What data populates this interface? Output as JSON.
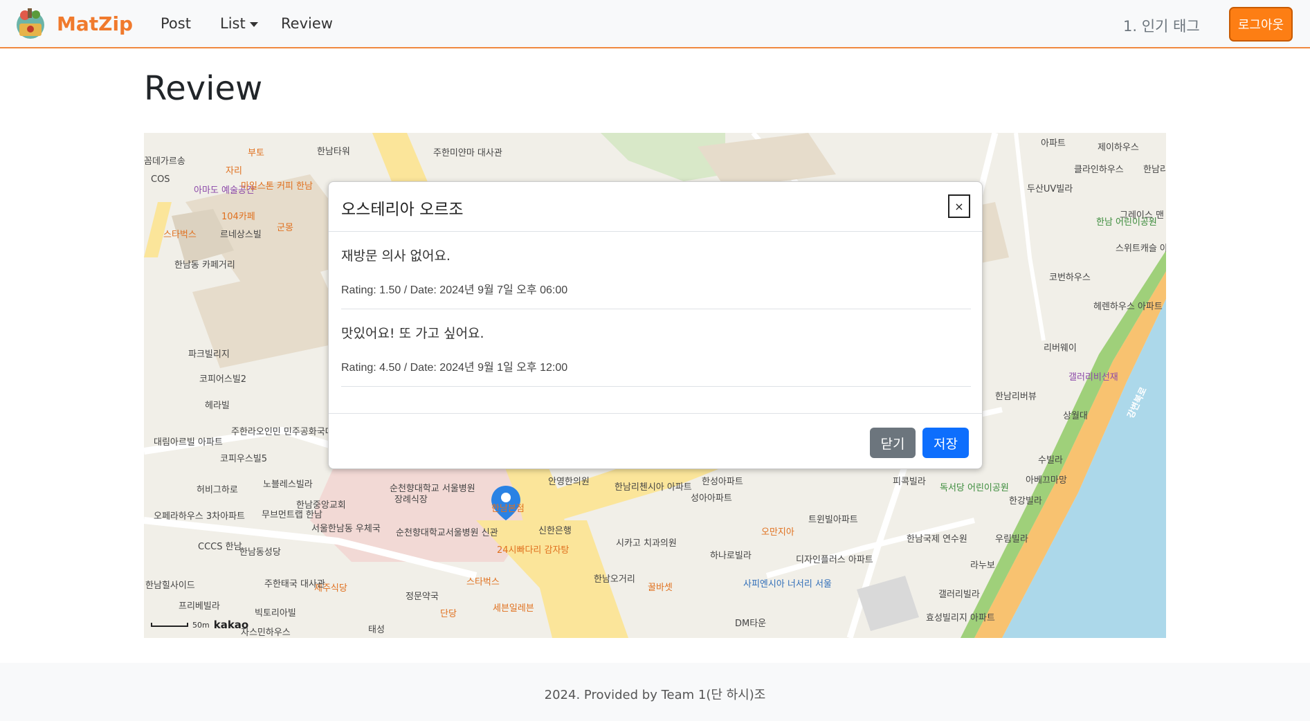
{
  "navbar": {
    "brand": "MatZip",
    "links": {
      "post": "Post",
      "list": "List",
      "review": "Review"
    },
    "tag_text": "1. 인기 태그",
    "logout_label": "로그아웃"
  },
  "page": {
    "title": "Review"
  },
  "map": {
    "scale_label": "50m",
    "logo": "kakao",
    "labels": {
      "l1": "꼼데가르송",
      "l2": "COS",
      "l3": "부토",
      "l4": "자리",
      "l5": "한남타워",
      "l6": "주한미얀마 대사관",
      "l7": "순천향대학교 서울병원",
      "l8": "안영한의원",
      "l9": "한남리첸시아 아파트",
      "l10": "한성아파트",
      "l11": "성아아파트",
      "l12": "피콕빌라",
      "l13": "독서당 어린이공원",
      "l14": "아베끄마망",
      "l15": "한강빌라",
      "l16": "우림빌라",
      "l17": "라누보",
      "l18": "갤러리빌라",
      "l19": "효성빌리지 아파트",
      "l20": "DM타운",
      "l21": "한남오거리",
      "l22": "하나로빌라",
      "l23": "디자인플러스 아파트",
      "l24": "사피엔시아 너서리 서울",
      "l25": "스타벅스",
      "l26": "세븐일레븐",
      "l27": "단당",
      "l28": "정문약국",
      "l29": "제주식당",
      "l30": "주한태국 대사관",
      "l31": "빅토리아빌",
      "l32": "프리베빌라",
      "l33": "한남힐사이드",
      "l34": "한남동성당",
      "l35": "서울한남동 우체국",
      "l36": "한남중앙교회",
      "l37": "무브먼트랩 한남",
      "l38": "노블레스빌라",
      "l39": "허비그하로",
      "l40": "대림아르빌 아파트",
      "l41": "주한라오인민 민주공화국대사관",
      "l42": "코피우스빌5",
      "l43": "헤라빌",
      "l44": "코피어스빌2",
      "l45": "파크빌리지",
      "l46": "한남동 카페거리",
      "l47": "르네상스빌",
      "l48": "군몽",
      "l49": "104카페",
      "l50": "스타벅스",
      "l51": "아마도 예술공간",
      "l52": "마일스톤 커피 한남",
      "l53": "제이하우스",
      "l54": "클라인하우스",
      "l55": "두산UV빌라",
      "l56": "한남 어린이공원",
      "l57": "스위트캐슬 아파트",
      "l58": "코번하우스",
      "l59": "헤렌하우스 아파트",
      "l60": "리버웨이",
      "l61": "갤러리비선재",
      "l62": "한남리버뷰",
      "l63": "상월대",
      "l64": "강변북로",
      "l65": "수빌라",
      "l66": "트윈빌아파트",
      "l67": "오만지아",
      "l68": "신한은행",
      "l69": "시카고 치과의원",
      "l70": "24시빠다리 감자탕",
      "l71": "장례식장",
      "l72": "순천향대학교서울병원 신관",
      "l73": "태성",
      "l74": "자스민하우스",
      "l75": "오페라하우스 3차아파트",
      "l76": "CCCS 한남",
      "l77": "한남국제 연수원",
      "l78": "그레이스 맨",
      "l79": "한남리",
      "l80": "아파트",
      "l81": "꿀바셋",
      "l82": "한남본점"
    }
  },
  "modal": {
    "title": "오스테리아 오르조",
    "close_symbol": "×",
    "reviews": [
      {
        "text": "재방문 의사 없어요.",
        "meta": "Rating: 1.50 / Date: 2024년 9월 7일 오후 06:00"
      },
      {
        "text": "맛있어요! 또 가고 싶어요.",
        "meta": "Rating: 4.50 / Date: 2024년 9월 1일 오후 12:00"
      }
    ],
    "close_label": "닫기",
    "save_label": "저장"
  },
  "footer": {
    "text": "2024. Provided by Team 1(단 하시)조"
  }
}
